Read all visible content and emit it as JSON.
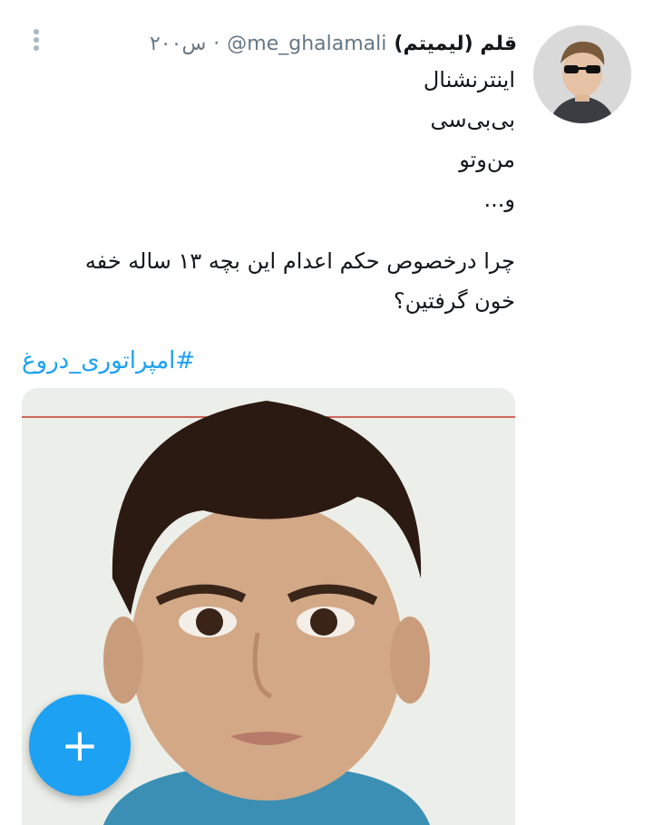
{
  "tweet": {
    "author": {
      "display_name": "قلم (لیمیتم)",
      "handle": "@me_ghalamali",
      "time": "۲۰۰س"
    },
    "separator": "·",
    "lines": [
      "اینترنشنال",
      "بی‌بی‌سی",
      "من‌وتو",
      "و..."
    ],
    "question_lines": [
      "چرا درخصوص حکم اعدام این بچه ۱۳ ساله خفه",
      "خون گرفتین؟"
    ],
    "hashtag": "#امپراتوری_دروغ"
  },
  "colors": {
    "accent": "#1da1f2",
    "secondary_text": "#657786"
  },
  "icons": {
    "more": "vertical-ellipsis-icon",
    "fab": "plus-icon"
  },
  "fab": {
    "label": "+"
  }
}
